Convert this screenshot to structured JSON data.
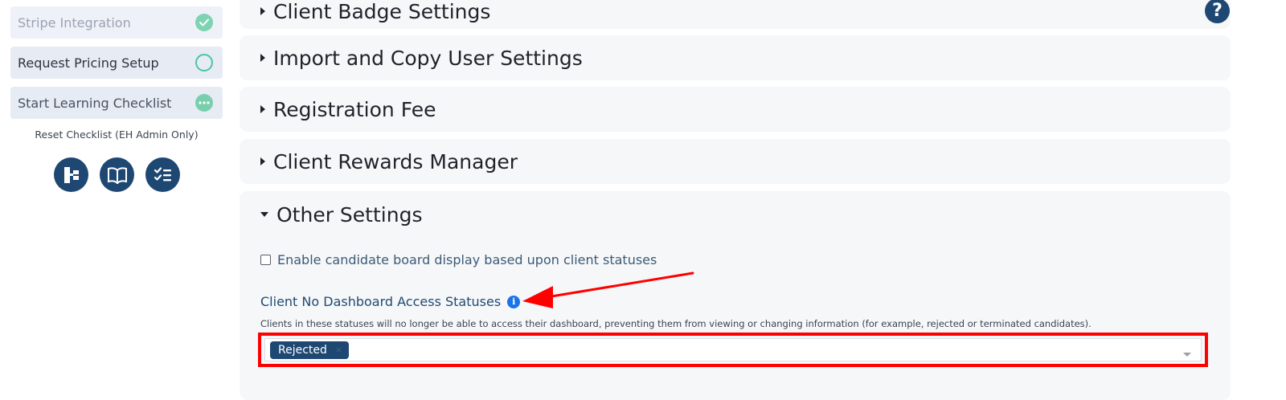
{
  "sidebar": {
    "checklist": [
      {
        "label": "Stripe Integration",
        "status": "done",
        "status_icon": "check-circle-icon"
      },
      {
        "label": "Request Pricing Setup",
        "status": "open",
        "status_icon": "empty-circle-icon"
      },
      {
        "label": "Start Learning Checklist",
        "status": "in-progress",
        "status_icon": "ellipsis-circle-icon"
      }
    ],
    "reset_label": "Reset Checklist (EH Admin Only)",
    "tools": [
      {
        "icon": "sitemap-icon"
      },
      {
        "icon": "book-icon"
      },
      {
        "icon": "checklist-icon"
      }
    ]
  },
  "sections": [
    {
      "title": "Client Badge Settings",
      "expanded": false
    },
    {
      "title": "Import and Copy User Settings",
      "expanded": false
    },
    {
      "title": "Registration Fee",
      "expanded": false
    },
    {
      "title": "Client Rewards Manager",
      "expanded": false
    },
    {
      "title": "Other Settings",
      "expanded": true
    }
  ],
  "help_button": {
    "label": "?"
  },
  "other_settings": {
    "checkbox_label": "Enable candidate board display based upon client statuses",
    "checkbox_checked": false,
    "field_label": "Client No Dashboard Access Statuses",
    "info_icon": "i",
    "field_help": "Clients in these statuses will no longer be able to access their dashboard, preventing them from viewing or changing information (for example, rejected or terminated candidates).",
    "selected_tags": [
      {
        "label": "Rejected",
        "remove": "×"
      }
    ]
  },
  "colors": {
    "brand": "#1e4872",
    "success": "#4cc59b",
    "annotation": "#ff0000",
    "info": "#1a73e8"
  }
}
